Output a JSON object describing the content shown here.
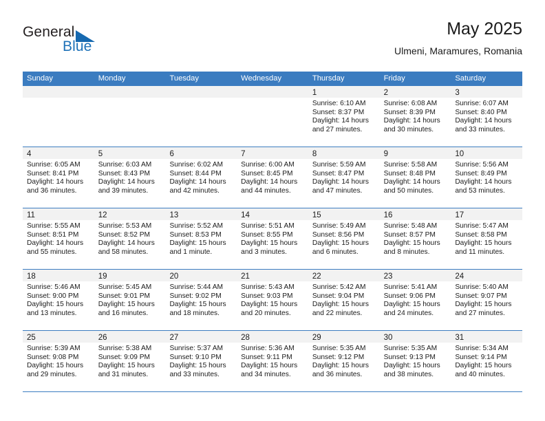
{
  "brand": {
    "line1": "General",
    "line2": "Blue",
    "triangle_color": "#1669b0",
    "blue_color": "#1d71b8"
  },
  "header": {
    "title": "May 2025",
    "subtitle": "Ulmeni, Maramures, Romania"
  },
  "theme": {
    "header_blue": "#3b7cc0",
    "daynum_band": "#f2f2f2",
    "text": "#1a1a1a"
  },
  "weekday_headers": [
    "Sunday",
    "Monday",
    "Tuesday",
    "Wednesday",
    "Thursday",
    "Friday",
    "Saturday"
  ],
  "weeks": [
    [
      {
        "day": "",
        "sunrise": "",
        "sunset": "",
        "daylight1": "",
        "daylight2": ""
      },
      {
        "day": "",
        "sunrise": "",
        "sunset": "",
        "daylight1": "",
        "daylight2": ""
      },
      {
        "day": "",
        "sunrise": "",
        "sunset": "",
        "daylight1": "",
        "daylight2": ""
      },
      {
        "day": "",
        "sunrise": "",
        "sunset": "",
        "daylight1": "",
        "daylight2": ""
      },
      {
        "day": "1",
        "sunrise": "Sunrise: 6:10 AM",
        "sunset": "Sunset: 8:37 PM",
        "daylight1": "Daylight: 14 hours",
        "daylight2": "and 27 minutes."
      },
      {
        "day": "2",
        "sunrise": "Sunrise: 6:08 AM",
        "sunset": "Sunset: 8:39 PM",
        "daylight1": "Daylight: 14 hours",
        "daylight2": "and 30 minutes."
      },
      {
        "day": "3",
        "sunrise": "Sunrise: 6:07 AM",
        "sunset": "Sunset: 8:40 PM",
        "daylight1": "Daylight: 14 hours",
        "daylight2": "and 33 minutes."
      }
    ],
    [
      {
        "day": "4",
        "sunrise": "Sunrise: 6:05 AM",
        "sunset": "Sunset: 8:41 PM",
        "daylight1": "Daylight: 14 hours",
        "daylight2": "and 36 minutes."
      },
      {
        "day": "5",
        "sunrise": "Sunrise: 6:03 AM",
        "sunset": "Sunset: 8:43 PM",
        "daylight1": "Daylight: 14 hours",
        "daylight2": "and 39 minutes."
      },
      {
        "day": "6",
        "sunrise": "Sunrise: 6:02 AM",
        "sunset": "Sunset: 8:44 PM",
        "daylight1": "Daylight: 14 hours",
        "daylight2": "and 42 minutes."
      },
      {
        "day": "7",
        "sunrise": "Sunrise: 6:00 AM",
        "sunset": "Sunset: 8:45 PM",
        "daylight1": "Daylight: 14 hours",
        "daylight2": "and 44 minutes."
      },
      {
        "day": "8",
        "sunrise": "Sunrise: 5:59 AM",
        "sunset": "Sunset: 8:47 PM",
        "daylight1": "Daylight: 14 hours",
        "daylight2": "and 47 minutes."
      },
      {
        "day": "9",
        "sunrise": "Sunrise: 5:58 AM",
        "sunset": "Sunset: 8:48 PM",
        "daylight1": "Daylight: 14 hours",
        "daylight2": "and 50 minutes."
      },
      {
        "day": "10",
        "sunrise": "Sunrise: 5:56 AM",
        "sunset": "Sunset: 8:49 PM",
        "daylight1": "Daylight: 14 hours",
        "daylight2": "and 53 minutes."
      }
    ],
    [
      {
        "day": "11",
        "sunrise": "Sunrise: 5:55 AM",
        "sunset": "Sunset: 8:51 PM",
        "daylight1": "Daylight: 14 hours",
        "daylight2": "and 55 minutes."
      },
      {
        "day": "12",
        "sunrise": "Sunrise: 5:53 AM",
        "sunset": "Sunset: 8:52 PM",
        "daylight1": "Daylight: 14 hours",
        "daylight2": "and 58 minutes."
      },
      {
        "day": "13",
        "sunrise": "Sunrise: 5:52 AM",
        "sunset": "Sunset: 8:53 PM",
        "daylight1": "Daylight: 15 hours",
        "daylight2": "and 1 minute."
      },
      {
        "day": "14",
        "sunrise": "Sunrise: 5:51 AM",
        "sunset": "Sunset: 8:55 PM",
        "daylight1": "Daylight: 15 hours",
        "daylight2": "and 3 minutes."
      },
      {
        "day": "15",
        "sunrise": "Sunrise: 5:49 AM",
        "sunset": "Sunset: 8:56 PM",
        "daylight1": "Daylight: 15 hours",
        "daylight2": "and 6 minutes."
      },
      {
        "day": "16",
        "sunrise": "Sunrise: 5:48 AM",
        "sunset": "Sunset: 8:57 PM",
        "daylight1": "Daylight: 15 hours",
        "daylight2": "and 8 minutes."
      },
      {
        "day": "17",
        "sunrise": "Sunrise: 5:47 AM",
        "sunset": "Sunset: 8:58 PM",
        "daylight1": "Daylight: 15 hours",
        "daylight2": "and 11 minutes."
      }
    ],
    [
      {
        "day": "18",
        "sunrise": "Sunrise: 5:46 AM",
        "sunset": "Sunset: 9:00 PM",
        "daylight1": "Daylight: 15 hours",
        "daylight2": "and 13 minutes."
      },
      {
        "day": "19",
        "sunrise": "Sunrise: 5:45 AM",
        "sunset": "Sunset: 9:01 PM",
        "daylight1": "Daylight: 15 hours",
        "daylight2": "and 16 minutes."
      },
      {
        "day": "20",
        "sunrise": "Sunrise: 5:44 AM",
        "sunset": "Sunset: 9:02 PM",
        "daylight1": "Daylight: 15 hours",
        "daylight2": "and 18 minutes."
      },
      {
        "day": "21",
        "sunrise": "Sunrise: 5:43 AM",
        "sunset": "Sunset: 9:03 PM",
        "daylight1": "Daylight: 15 hours",
        "daylight2": "and 20 minutes."
      },
      {
        "day": "22",
        "sunrise": "Sunrise: 5:42 AM",
        "sunset": "Sunset: 9:04 PM",
        "daylight1": "Daylight: 15 hours",
        "daylight2": "and 22 minutes."
      },
      {
        "day": "23",
        "sunrise": "Sunrise: 5:41 AM",
        "sunset": "Sunset: 9:06 PM",
        "daylight1": "Daylight: 15 hours",
        "daylight2": "and 24 minutes."
      },
      {
        "day": "24",
        "sunrise": "Sunrise: 5:40 AM",
        "sunset": "Sunset: 9:07 PM",
        "daylight1": "Daylight: 15 hours",
        "daylight2": "and 27 minutes."
      }
    ],
    [
      {
        "day": "25",
        "sunrise": "Sunrise: 5:39 AM",
        "sunset": "Sunset: 9:08 PM",
        "daylight1": "Daylight: 15 hours",
        "daylight2": "and 29 minutes."
      },
      {
        "day": "26",
        "sunrise": "Sunrise: 5:38 AM",
        "sunset": "Sunset: 9:09 PM",
        "daylight1": "Daylight: 15 hours",
        "daylight2": "and 31 minutes."
      },
      {
        "day": "27",
        "sunrise": "Sunrise: 5:37 AM",
        "sunset": "Sunset: 9:10 PM",
        "daylight1": "Daylight: 15 hours",
        "daylight2": "and 33 minutes."
      },
      {
        "day": "28",
        "sunrise": "Sunrise: 5:36 AM",
        "sunset": "Sunset: 9:11 PM",
        "daylight1": "Daylight: 15 hours",
        "daylight2": "and 34 minutes."
      },
      {
        "day": "29",
        "sunrise": "Sunrise: 5:35 AM",
        "sunset": "Sunset: 9:12 PM",
        "daylight1": "Daylight: 15 hours",
        "daylight2": "and 36 minutes."
      },
      {
        "day": "30",
        "sunrise": "Sunrise: 5:35 AM",
        "sunset": "Sunset: 9:13 PM",
        "daylight1": "Daylight: 15 hours",
        "daylight2": "and 38 minutes."
      },
      {
        "day": "31",
        "sunrise": "Sunrise: 5:34 AM",
        "sunset": "Sunset: 9:14 PM",
        "daylight1": "Daylight: 15 hours",
        "daylight2": "and 40 minutes."
      }
    ]
  ]
}
